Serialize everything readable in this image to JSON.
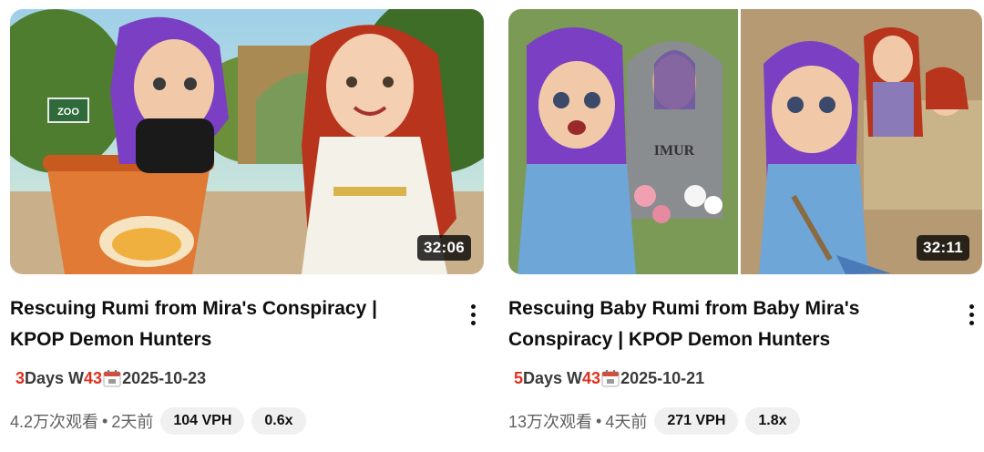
{
  "videos": [
    {
      "duration": "32:06",
      "title": "Rescuing Rumi from Mira's Conspiracy | KPOP Demon Hunters",
      "days_num": "3",
      "days_label": "Days W",
      "week_num": "43",
      "calendar_icon": "calendar-icon",
      "date": "2025-10-23",
      "views": "4.2万次观看",
      "separator": "•",
      "age": "2天前",
      "vph": "104 VPH",
      "ratio": "0.6x"
    },
    {
      "duration": "32:11",
      "title": "Rescuing Baby Rumi from Baby Mira's Conspiracy | KPOP Demon Hunters",
      "days_num": "5",
      "days_label": "Days W",
      "week_num": "43",
      "calendar_icon": "calendar-icon",
      "date": "2025-10-21",
      "views": "13万次观看",
      "separator": "•",
      "age": "4天前",
      "vph": "271 VPH",
      "ratio": "1.8x"
    }
  ],
  "thumbnail_text": {
    "zoo_sign": "ZOO",
    "tombstone": "IMUR"
  },
  "colors": {
    "accent_red": "#e0301e",
    "chip_bg": "#f0f0f0",
    "text_primary": "#0f0f0f",
    "text_secondary": "#606060"
  }
}
